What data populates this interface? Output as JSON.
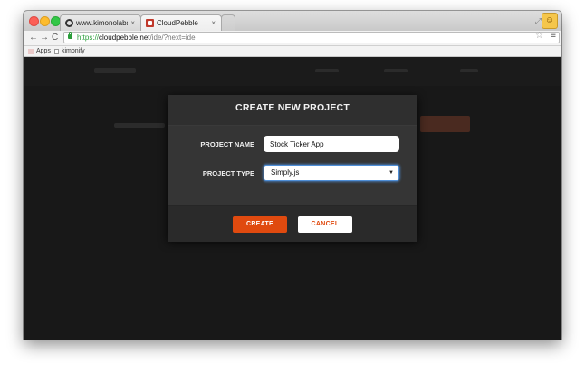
{
  "browser": {
    "tabs": [
      {
        "title": "www.kimonolabs.com/ap",
        "close": "×",
        "favicon": "kimono-icon"
      },
      {
        "title": "CloudPebble",
        "close": "×",
        "favicon": "cloudpebble-icon",
        "active": true
      }
    ],
    "nav": {
      "back": "←",
      "forward": "→",
      "reload": "C"
    },
    "url": {
      "scheme": "https://",
      "host": "cloudpebble.net",
      "path": "/ide/?next=ide"
    },
    "bookmarks": [
      {
        "label": "Apps",
        "icon": "apps-grid-icon"
      },
      {
        "label": "kimonify",
        "icon": "page-icon"
      }
    ],
    "icons": {
      "star": "☆",
      "menu": "≡",
      "resize": "⤢",
      "user": "☺"
    }
  },
  "modal": {
    "title": "CREATE NEW PROJECT",
    "project_name_label": "PROJECT NAME",
    "project_name_value": "Stock Ticker App",
    "project_type_label": "PROJECT TYPE",
    "project_type_value": "Simply.js",
    "create_label": "CREATE",
    "cancel_label": "CANCEL"
  },
  "colors": {
    "accent": "#e04a0f",
    "backdrop": "#181818",
    "modal_body": "#353535",
    "focus_ring": "#4f8fd8"
  }
}
